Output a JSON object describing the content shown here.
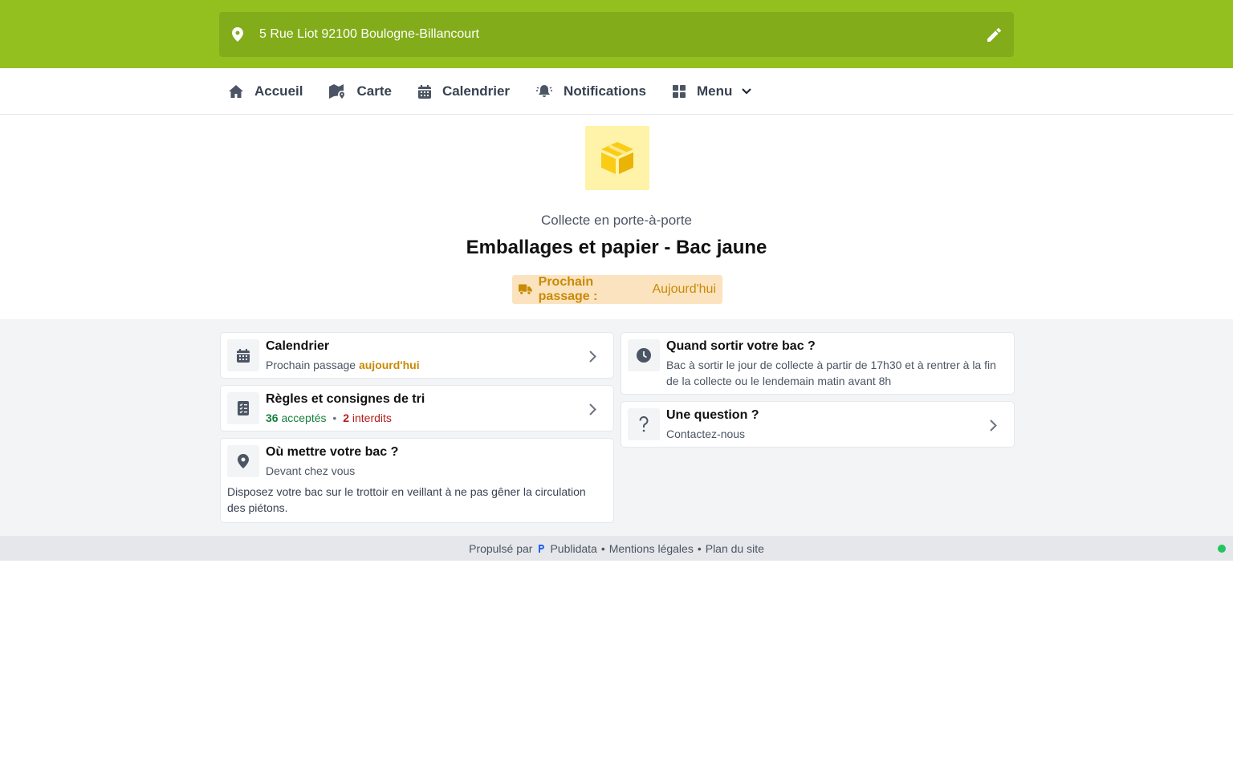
{
  "address": {
    "text": "5 Rue Liot 92100 Boulogne-Billancourt"
  },
  "nav": {
    "items": [
      {
        "label": "Accueil",
        "icon": "home-icon"
      },
      {
        "label": "Carte",
        "icon": "map-icon"
      },
      {
        "label": "Calendrier",
        "icon": "calendar-icon"
      },
      {
        "label": "Notifications",
        "icon": "bell-icon"
      },
      {
        "label": "Menu",
        "icon": "grid-icon"
      }
    ]
  },
  "hero": {
    "icon": "box-icon",
    "subtitle": "Collecte en porte-à-porte",
    "title": "Emballages et papier - Bac jaune",
    "badge_label": "Prochain passage :",
    "badge_value": "Aujourd'hui"
  },
  "cards": {
    "calendar": {
      "title": "Calendrier",
      "sub_prefix": "Prochain passage",
      "sub_value": "aujourd'hui"
    },
    "rules": {
      "title": "Règles et consignes de tri",
      "accepted_count": "36",
      "accepted_label": "acceptés",
      "separator": "•",
      "forbidden_count": "2",
      "forbidden_label": "interdits"
    },
    "where": {
      "title": "Où mettre votre bac ?",
      "subtitle": "Devant chez vous",
      "body": "Disposez votre bac sur le trottoir en veillant à ne pas gêner la circulation des piétons."
    },
    "when": {
      "title": "Quand sortir votre bac ?",
      "body": "Bac à sortir le jour de collecte à partir de 17h30 et à rentrer à la fin de la collecte ou le lendemain matin avant 8h"
    },
    "question": {
      "title": "Une question ?",
      "subtitle": "Contactez-nous"
    }
  },
  "footer": {
    "powered_by": "Propulsé par",
    "brand": "Publidata",
    "separator": "•",
    "legal": "Mentions légales",
    "sitemap": "Plan du site"
  },
  "colors": {
    "brand_green": "#93c01f",
    "address_bg": "#82ac1a",
    "accent_orange": "#c98a06",
    "badge_bg": "#fbe3bf",
    "icon_tile_yellow": "#fef3a8",
    "status_green": "#22c55e"
  }
}
